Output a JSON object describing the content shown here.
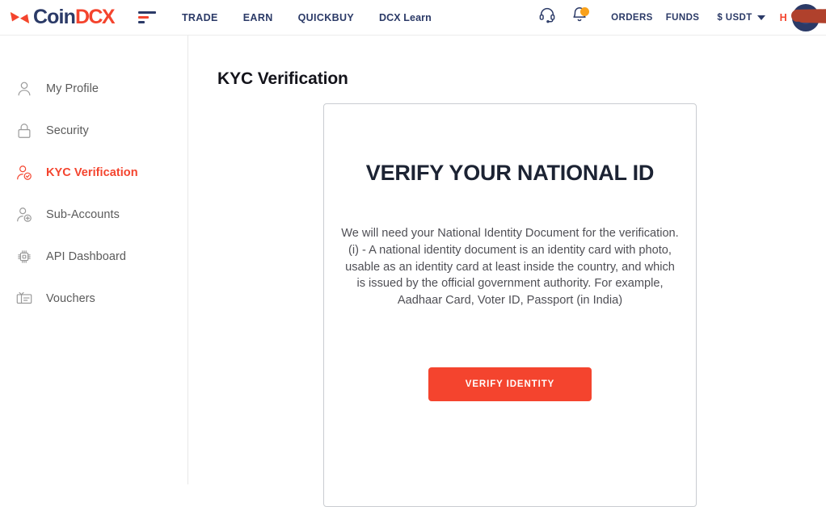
{
  "header": {
    "logo": {
      "icon": "coindcx-butterfly-logo",
      "text_primary": "Coin",
      "text_secondary": "DCX"
    },
    "menu_icon": "hamburger-menu-icon",
    "nav_links": [
      {
        "label": "TRADE"
      },
      {
        "label": "EARN"
      },
      {
        "label": "QUICKBUY"
      },
      {
        "label": "DCX Learn"
      }
    ],
    "support_icon": "headset-support-icon",
    "notification_icon": "bell-notification-icon",
    "notification_badge": true,
    "orders_label": "ORDERS",
    "funds_label": "FUNDS",
    "currency_label": "$ USDT",
    "currency_caret": "chevron-down-icon",
    "user_name": "H",
    "user_name_redacted": true,
    "avatar": "user-avatar"
  },
  "sidebar": {
    "items": [
      {
        "label": "My Profile",
        "icon": "user-profile-icon",
        "active": false
      },
      {
        "label": "Security",
        "icon": "lock-icon",
        "active": false
      },
      {
        "label": "KYC Verification",
        "icon": "user-verified-icon",
        "active": true
      },
      {
        "label": "Sub-Accounts",
        "icon": "user-add-icon",
        "active": false
      },
      {
        "label": "API Dashboard",
        "icon": "chip-icon",
        "active": false
      },
      {
        "label": "Vouchers",
        "icon": "gift-voucher-icon",
        "active": false
      }
    ]
  },
  "main": {
    "page_title": "KYC Verification",
    "card": {
      "heading": "VERIFY YOUR NATIONAL ID",
      "body_line_1": "We will need your National Identity Document for the verification.",
      "body_line_2": "(i) - A national identity document is an identity card with photo, usable as an identity card at least inside the country, and which is issued by the official government authority. For example, Aadhaar Card, Voter ID, Passport (in India)",
      "button_label": "VERIFY IDENTITY"
    }
  },
  "colors": {
    "brand_orange": "#f4442e",
    "brand_navy": "#2b3a67",
    "badge_orange": "#f9a11b",
    "text_dark": "#1c2333",
    "text_body": "#4f4f55",
    "border_gray": "#c9ccd1"
  }
}
